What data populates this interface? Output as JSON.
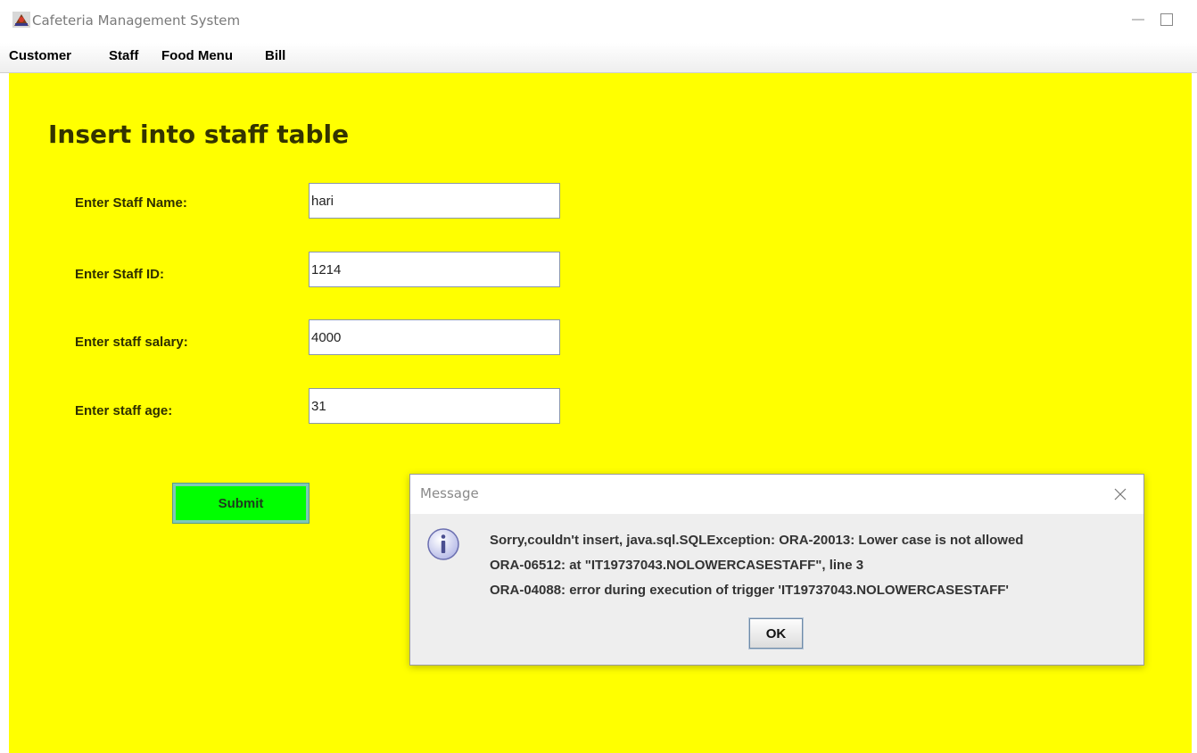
{
  "window": {
    "title": "Cafeteria Management System"
  },
  "menu": {
    "items": [
      "Customer",
      "Staff",
      "Food Menu",
      "Bill"
    ]
  },
  "form": {
    "heading": "Insert into staff table",
    "fields": [
      {
        "label": "Enter Staff Name:",
        "value": "hari"
      },
      {
        "label": "Enter Staff ID:",
        "value": "1214"
      },
      {
        "label": "Enter staff salary:",
        "value": "4000"
      },
      {
        "label": "Enter staff age:",
        "value": "31"
      }
    ],
    "submit_label": "Submit"
  },
  "dialog": {
    "title": "Message",
    "lines": [
      "Sorry,couldn't insert, java.sql.SQLException: ORA-20013: Lower case is not allowed",
      "ORA-06512: at \"IT19737043.NOLOWERCASESTAFF\", line 3",
      "ORA-04088: error during execution of trigger 'IT19737043.NOLOWERCASESTAFF'"
    ],
    "ok_label": "OK",
    "icon": "info-icon"
  },
  "colors": {
    "background": "#ffff00",
    "submit_button": "#00ff00",
    "dialog_background": "#eeeeee"
  }
}
